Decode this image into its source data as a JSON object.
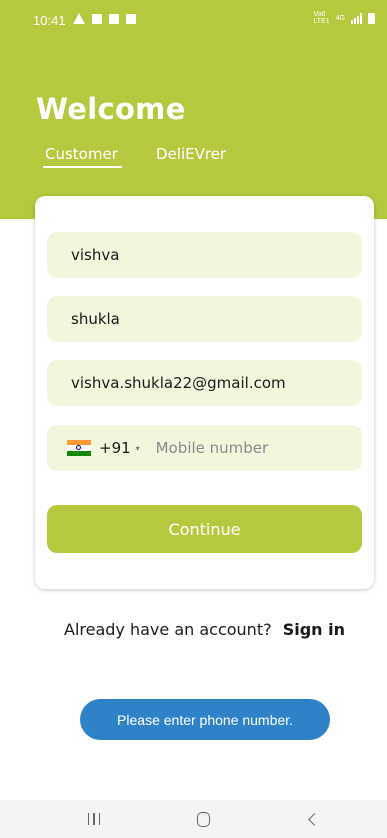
{
  "status_bar": {
    "time": "10:41",
    "network_top": "Vo0",
    "network_bottom": "LTE1",
    "network_type": "4G"
  },
  "header": {
    "title": "Welcome",
    "tabs": [
      {
        "label": "Customer",
        "selected": true
      },
      {
        "label": "DeliEVrer",
        "selected": false
      }
    ],
    "background_color": "#b6c93e"
  },
  "form": {
    "first_name_value": "vishva",
    "last_name_value": "shukla",
    "email_value": "vishva.shukla22@gmail.com",
    "phone": {
      "country_flag": "india-flag-icon",
      "dial_code": "+91",
      "caret": "▾",
      "placeholder": "Mobile number",
      "value": ""
    },
    "continue_label": "Continue"
  },
  "footer": {
    "prompt": "Already have an account?",
    "signin_label": "Sign in"
  },
  "toast": {
    "message": "Please enter phone number.",
    "color": "#2f82c7"
  },
  "navigation": {
    "recent_icon": "recent-apps-icon",
    "home_icon": "home-icon",
    "back_icon": "back-icon"
  }
}
